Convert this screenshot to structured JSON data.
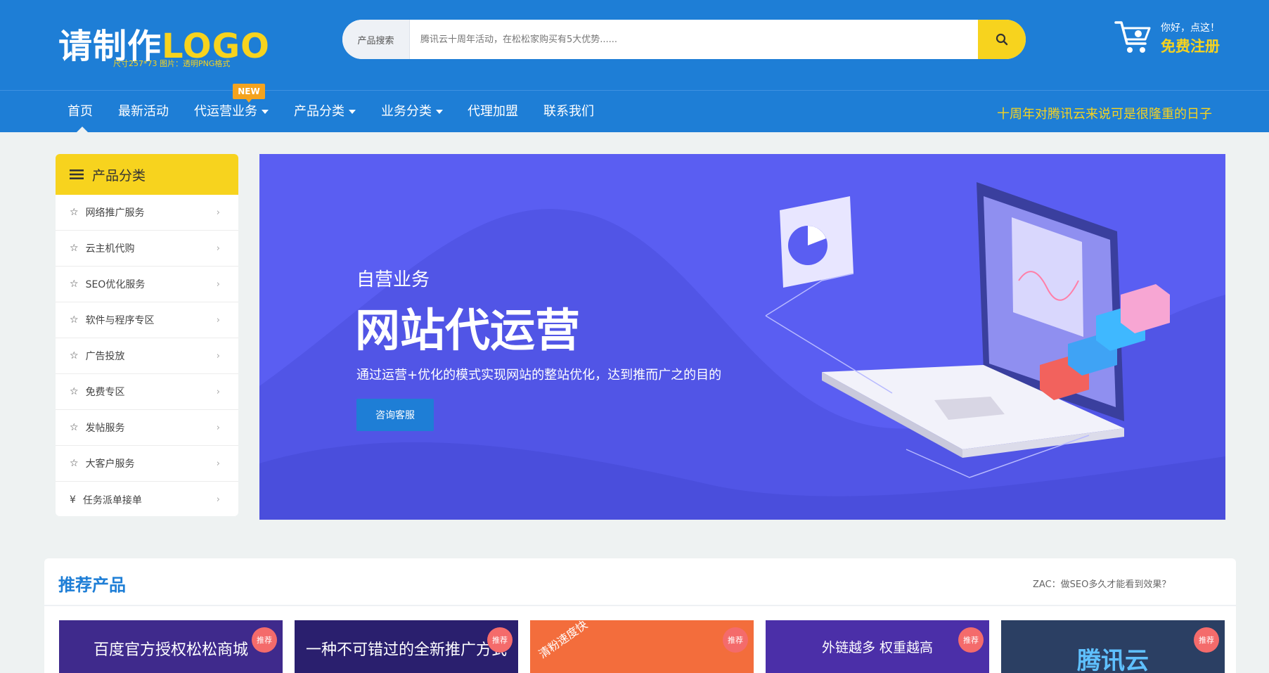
{
  "header": {
    "logo_text_cn": "请制作",
    "logo_text_en": "LOGO",
    "logo_note": "尺寸257*73 图片：透明PNG格式",
    "search": {
      "label": "产品搜索",
      "placeholder": "腾讯云十周年活动，在松松家购买有5大优势......"
    },
    "greeting": "你好，点这！",
    "register": "免费注册"
  },
  "nav": {
    "items": [
      {
        "label": "首页",
        "active": true
      },
      {
        "label": "最新活动"
      },
      {
        "label": "代运营业务",
        "dropdown": true,
        "badge": "NEW"
      },
      {
        "label": "产品分类",
        "dropdown": true
      },
      {
        "label": "业务分类",
        "dropdown": true
      },
      {
        "label": "代理加盟"
      },
      {
        "label": "联系我们"
      }
    ],
    "slogan": "十周年对腾讯云来说可是很隆重的日子"
  },
  "sidebar": {
    "title": "产品分类",
    "items": [
      {
        "label": "网络推广服务",
        "icon": "star-icon"
      },
      {
        "label": "云主机代购",
        "icon": "star-icon"
      },
      {
        "label": "SEO优化服务",
        "icon": "star-icon"
      },
      {
        "label": "软件与程序专区",
        "icon": "star-icon"
      },
      {
        "label": "广告投放",
        "icon": "star-icon"
      },
      {
        "label": "免费专区",
        "icon": "star-icon"
      },
      {
        "label": "发帖服务",
        "icon": "star-icon"
      },
      {
        "label": "大客户服务",
        "icon": "star-icon"
      },
      {
        "label": "任务派单接单",
        "icon": "yen-icon",
        "glyph": "¥"
      }
    ]
  },
  "banner": {
    "subtitle": "自营业务",
    "title": "网站代运营",
    "description": "通过运营+优化的模式实现网站的整站优化，达到推而广之的目的",
    "button": "咨询客服"
  },
  "recommended": {
    "title": "推荐产品",
    "link": "ZAC：做SEO多久才能看到效果？",
    "cards": [
      {
        "text": "百度官方授权松松商城",
        "badge": "推荐",
        "bg": "#3f2a8c"
      },
      {
        "text": "一种不可错过的全新推广方式",
        "badge": "推荐",
        "bg": "#2a1f6e"
      },
      {
        "text": "清粉速度快",
        "badge": "推荐",
        "bg": "#f36d3c"
      },
      {
        "text": "外链越多 权重越高",
        "badge": "推荐",
        "bg": "#4b2fa8"
      },
      {
        "text": "腾讯云",
        "badge": "推荐",
        "bg": "#2b3f63"
      }
    ]
  },
  "colors": {
    "primary": "#1e7ed6",
    "accent": "#f7d31e",
    "banner": "#5a5ef2",
    "badge": "#f46b6b"
  }
}
